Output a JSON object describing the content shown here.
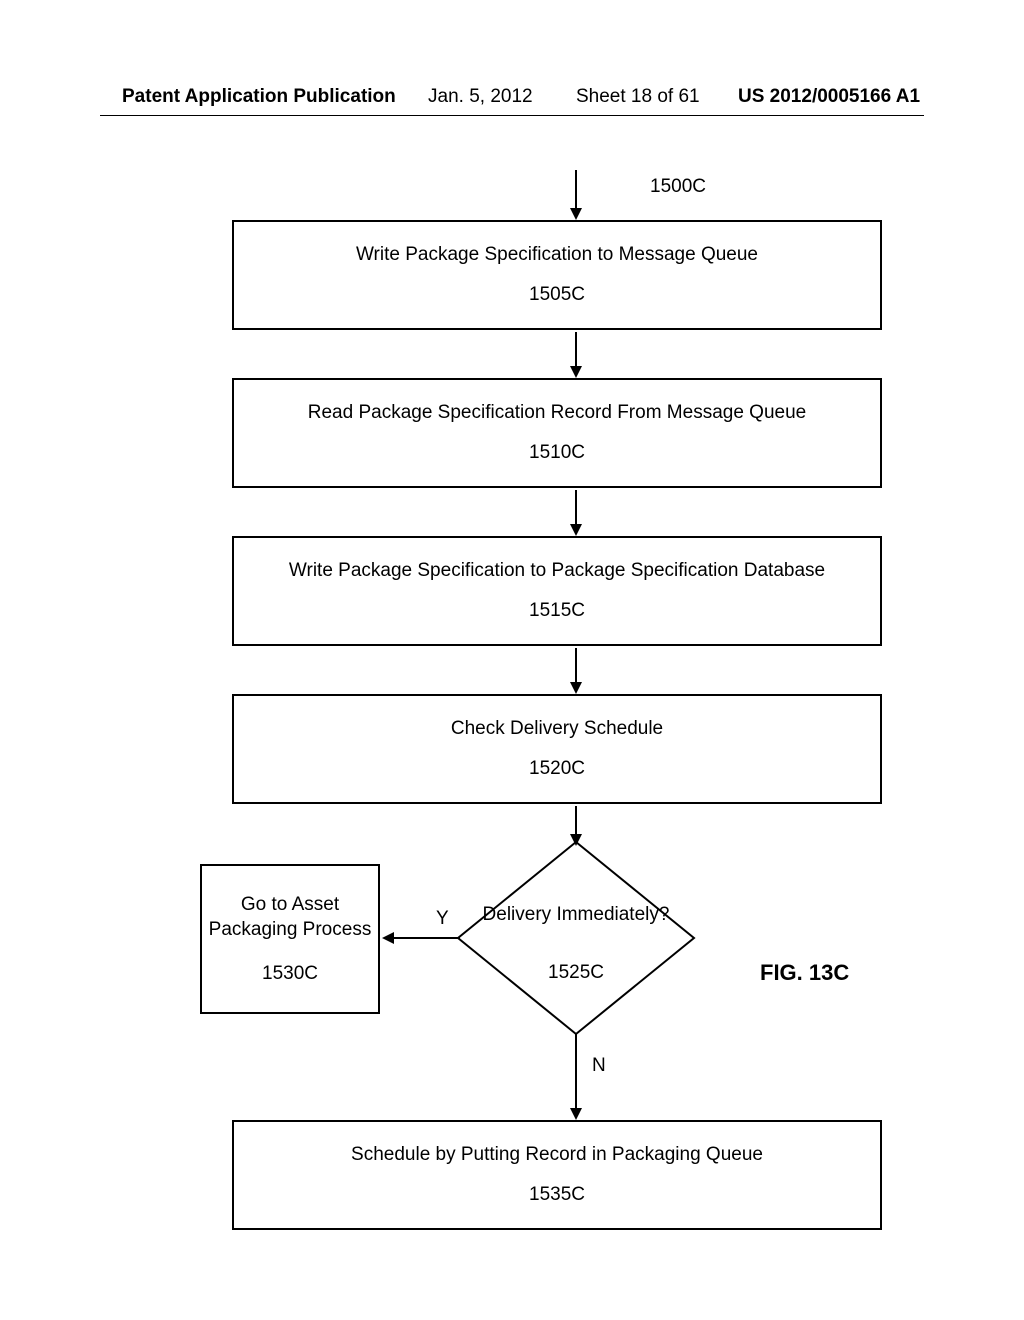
{
  "header": {
    "pub_type": "Patent Application Publication",
    "date": "Jan. 5, 2012",
    "sheet": "Sheet 18 of 61",
    "pub_num": "US 2012/0005166 A1"
  },
  "figure_ref": "1500C",
  "steps": {
    "s1505": {
      "title": "Write Package Specification to Message Queue",
      "ref": "1505C"
    },
    "s1510": {
      "title": "Read Package Specification Record From Message Queue",
      "ref": "1510C"
    },
    "s1515": {
      "title": "Write Package Specification to Package Specification Database",
      "ref": "1515C"
    },
    "s1520": {
      "title": "Check Delivery Schedule",
      "ref": "1520C"
    },
    "s1525": {
      "title": "Delivery Immediately?",
      "ref": "1525C"
    },
    "s1530": {
      "title": "Go to Asset Packaging Process",
      "ref": "1530C"
    },
    "s1535": {
      "title": "Schedule by Putting Record in Packaging Queue",
      "ref": "1535C"
    }
  },
  "branches": {
    "yes": "Y",
    "no": "N"
  },
  "figure_label": "FIG. 13C"
}
